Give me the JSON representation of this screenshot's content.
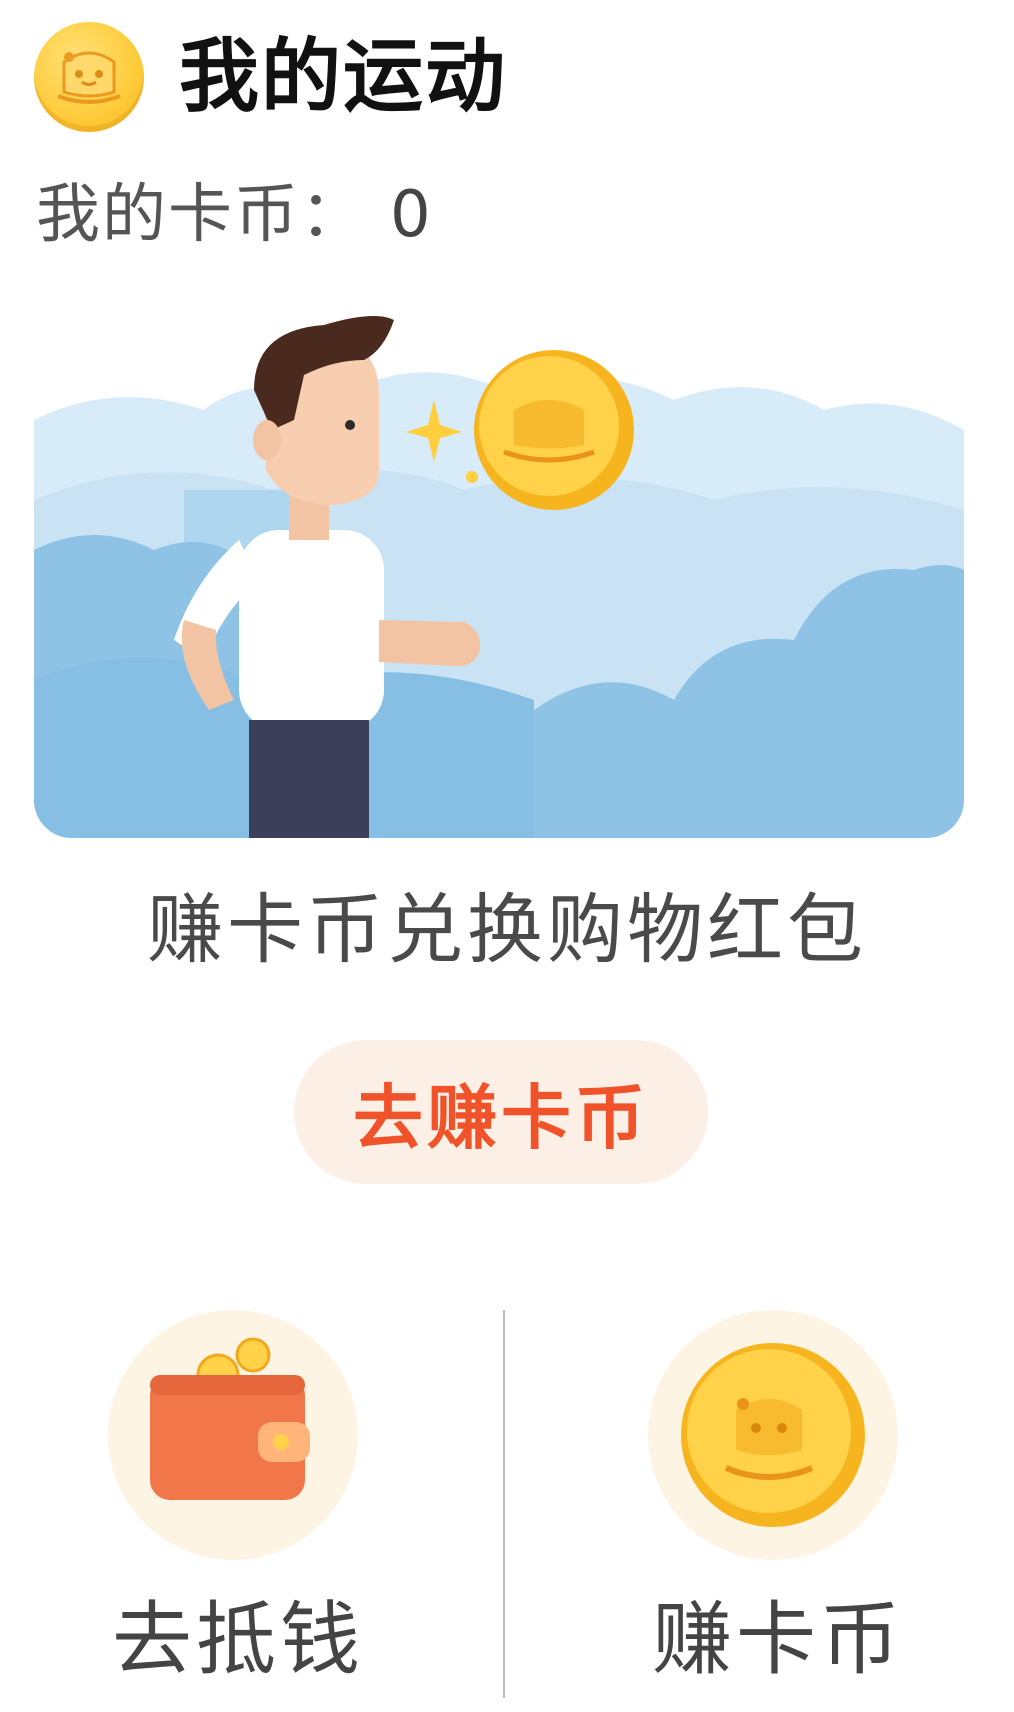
{
  "header": {
    "title": "我的运动",
    "icon": "coin-mascot-icon"
  },
  "coins": {
    "label": "我的卡币：",
    "value": "0"
  },
  "banner": {
    "illustration": "running-man-coin-illustration"
  },
  "promo": {
    "text": "赚卡币兑换购物红包"
  },
  "earn_button": {
    "label": "去赚卡币"
  },
  "actions": [
    {
      "label": "去抵钱",
      "icon": "wallet-icon"
    },
    {
      "label": "赚卡币",
      "icon": "coin-icon"
    }
  ],
  "colors": {
    "accent": "#f0522a",
    "button_bg": "#fcefe6",
    "coin": "#ffcb3a",
    "sky": "#cfe6f6",
    "cloud": "#8ec3e6"
  }
}
